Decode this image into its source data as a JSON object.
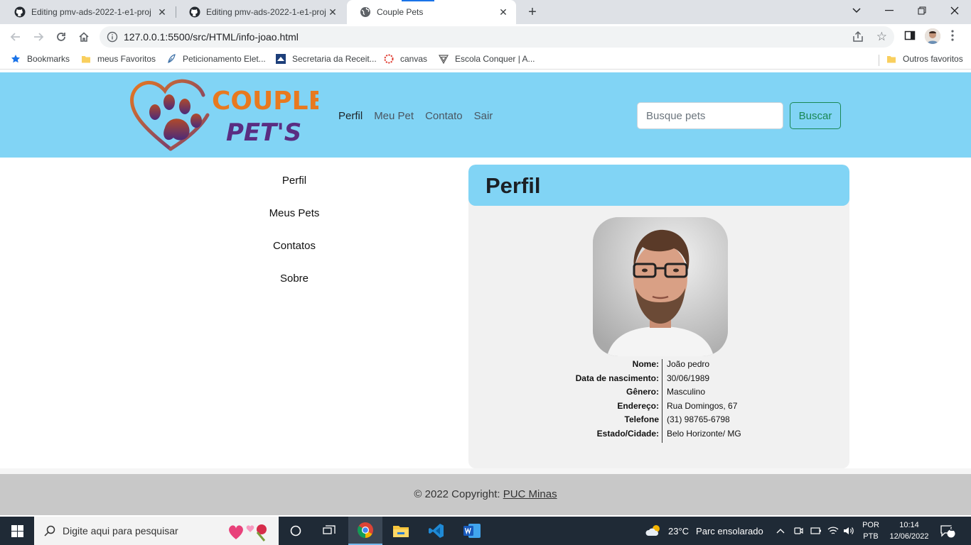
{
  "browser": {
    "tabs": [
      {
        "label": "Editing pmv-ads-2022-1-e1-proj",
        "icon": "github-icon"
      },
      {
        "label": "Editing pmv-ads-2022-1-e1-proj",
        "icon": "github-icon"
      },
      {
        "label": "Couple Pets",
        "icon": "globe-icon"
      }
    ],
    "url": "127.0.0.1:5500/src/HTML/info-joao.html",
    "bookmarks": [
      {
        "label": "Bookmarks",
        "icon": "star-icon"
      },
      {
        "label": "meus Favoritos",
        "icon": "folder-icon"
      },
      {
        "label": "Peticionamento Elet...",
        "icon": "feather-icon"
      },
      {
        "label": "Secretaria da Receit...",
        "icon": "receita-icon"
      },
      {
        "label": "canvas",
        "icon": "canvas-icon"
      },
      {
        "label": "Escola Conquer | A...",
        "icon": "conquer-icon"
      }
    ],
    "other_bookmarks": "Outros favoritos"
  },
  "site": {
    "logo": {
      "line1": "COUPLE",
      "line2": "PET'S"
    },
    "nav": [
      {
        "label": "Perfil",
        "active": true
      },
      {
        "label": "Meu Pet",
        "active": false
      },
      {
        "label": "Contato",
        "active": false
      },
      {
        "label": "Sair",
        "active": false
      }
    ],
    "search": {
      "placeholder": "Busque pets",
      "button": "Buscar"
    },
    "sidebar": [
      "Perfil",
      "Meus Pets",
      "Contatos",
      "Sobre"
    ],
    "profile": {
      "title": "Perfil",
      "fields": [
        {
          "label": "Nome:",
          "value": "João pedro"
        },
        {
          "label": "Data de nascimento:",
          "value": "30/06/1989"
        },
        {
          "label": "Gênero:",
          "value": "Masculino"
        },
        {
          "label": "Endereço:",
          "value": "Rua Domingos, 67"
        },
        {
          "label": "Telefone",
          "value": "(31) 98765-6798"
        },
        {
          "label": "Estado/Cidade:",
          "value": "Belo Horizonte/ MG"
        }
      ]
    },
    "footer": {
      "text": "© 2022 Copyright: ",
      "link": "PUC Minas"
    }
  },
  "taskbar": {
    "search_placeholder": "Digite aqui para pesquisar",
    "weather": {
      "temp": "23°C",
      "desc": "Parc ensolarado"
    },
    "language": {
      "line1": "POR",
      "line2": "PTB"
    },
    "time": "10:14",
    "date": "12/06/2022",
    "notifications": "2"
  },
  "colors": {
    "header_bg": "#81d4f5",
    "card_bg": "#f1f1f1",
    "button_green": "#198754",
    "footer_bg": "#c8c8c8",
    "taskbar_bg": "#1f2a36"
  }
}
